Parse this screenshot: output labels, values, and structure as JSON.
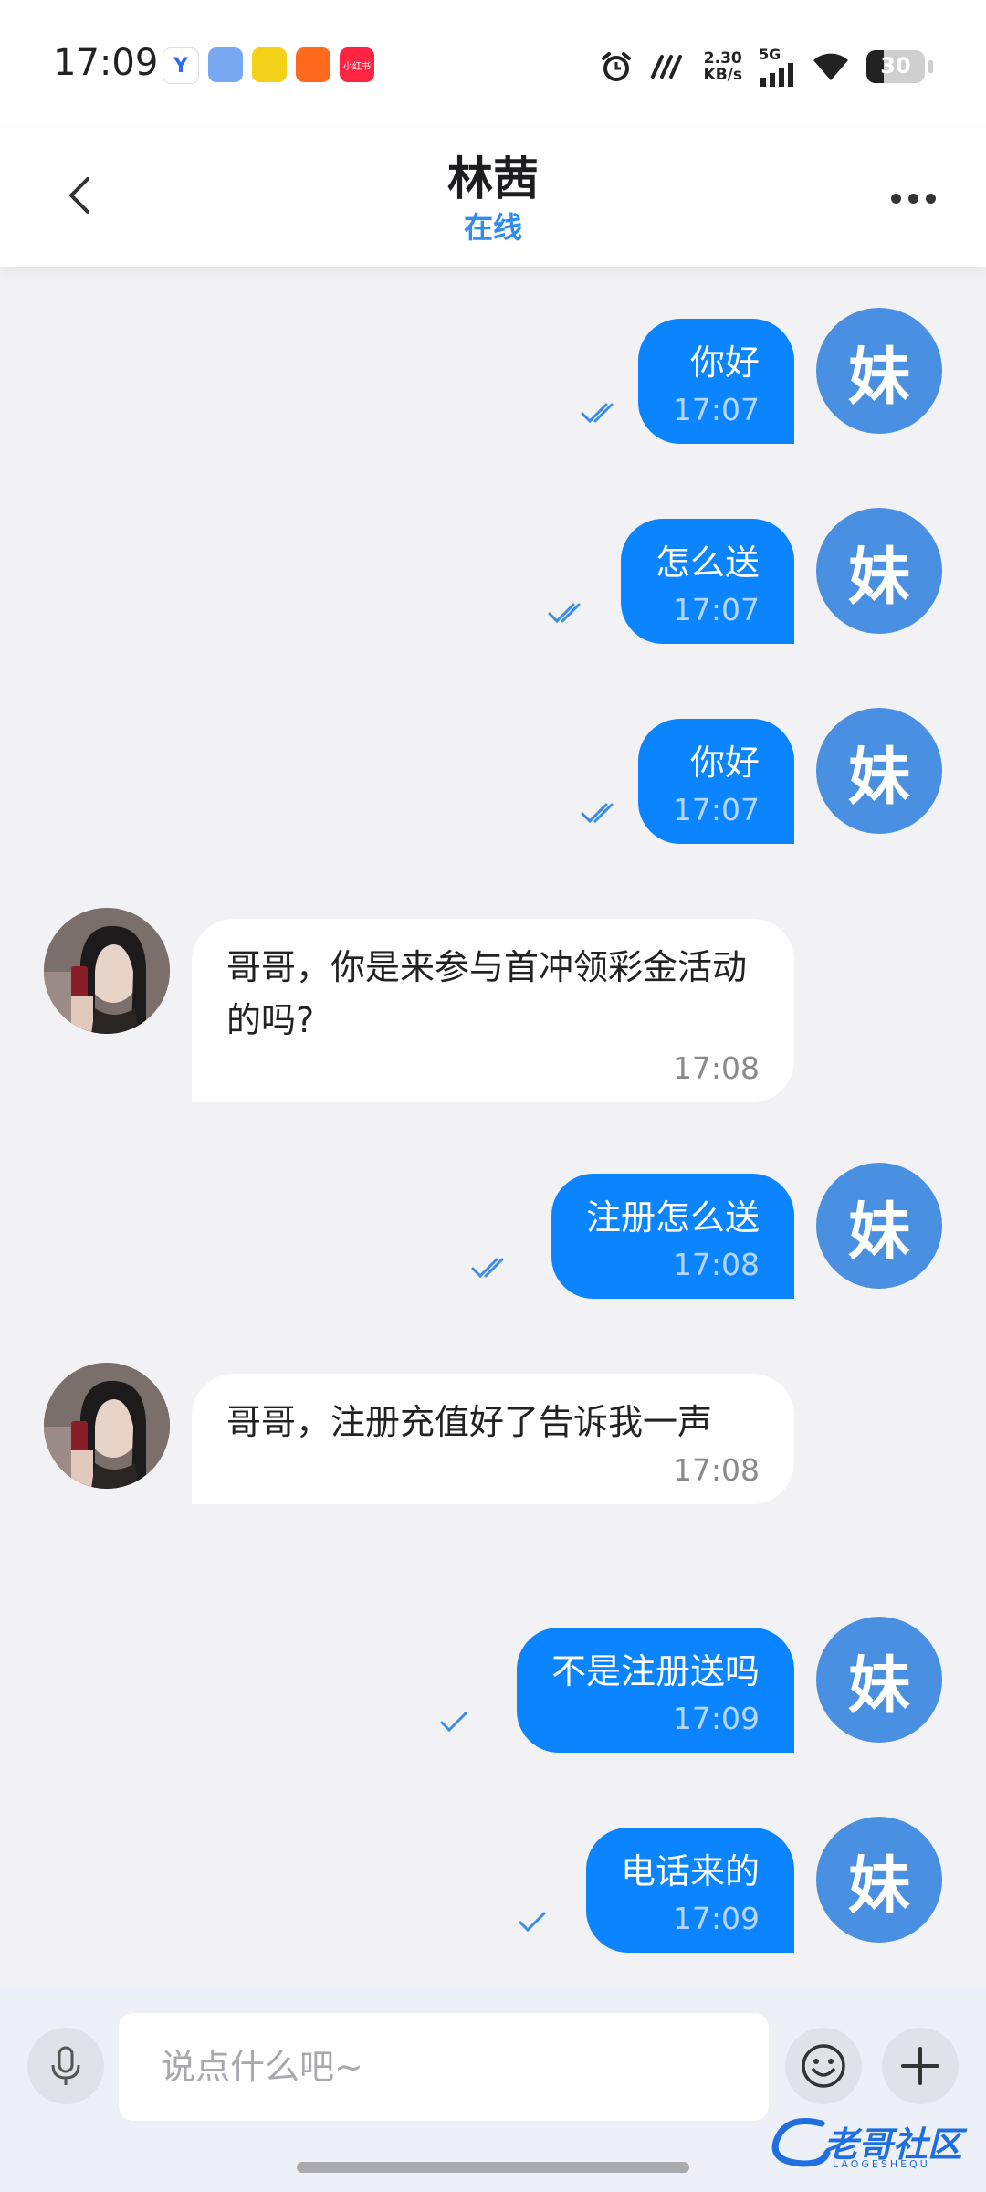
{
  "status_bar": {
    "time": "17:09",
    "app_icons": [
      {
        "name": "app-icon-1",
        "color": "#ffffff",
        "label": "Y"
      },
      {
        "name": "app-icon-2",
        "color": "#79a8f2",
        "label": ""
      },
      {
        "name": "app-icon-3",
        "color": "#f5d21a",
        "label": ""
      },
      {
        "name": "app-icon-4",
        "color": "#ff6a1f",
        "label": ""
      },
      {
        "name": "app-icon-5",
        "color": "#ff2442",
        "label": "小红书"
      }
    ],
    "net_speed_value": "2.30",
    "net_speed_unit": "KB/s",
    "network": "5G",
    "battery": "30",
    "battery_level": 0.3
  },
  "header": {
    "title": "林茜",
    "status": "在线"
  },
  "me_avatar_text": "妹",
  "messages": [
    {
      "dir": "out",
      "text": "你好",
      "time": "17:07",
      "ticks": 2
    },
    {
      "dir": "out",
      "text": "怎么送",
      "time": "17:07",
      "ticks": 2
    },
    {
      "dir": "out",
      "text": "你好",
      "time": "17:07",
      "ticks": 2
    },
    {
      "dir": "in",
      "text": "哥哥，你是来参与首冲领彩金活动的吗?",
      "time": "17:08"
    },
    {
      "dir": "out",
      "text": "注册怎么送",
      "time": "17:08",
      "ticks": 2
    },
    {
      "dir": "in",
      "text": "哥哥，注册充值好了告诉我一声",
      "time": "17:08"
    },
    {
      "dir": "out",
      "text": "不是注册送吗",
      "time": "17:09",
      "ticks": 1
    },
    {
      "dir": "out",
      "text": "电话来的",
      "time": "17:09",
      "ticks": 1
    }
  ],
  "input": {
    "placeholder": "说点什么吧~",
    "value": ""
  },
  "watermark": {
    "text": "老哥社区",
    "sub": "LAOGESHEQU"
  },
  "colors": {
    "accent": "#0a84ff",
    "online": "#2f8cf0",
    "me_avatar": "#4a90e2",
    "tick": "#3a8ee8"
  }
}
